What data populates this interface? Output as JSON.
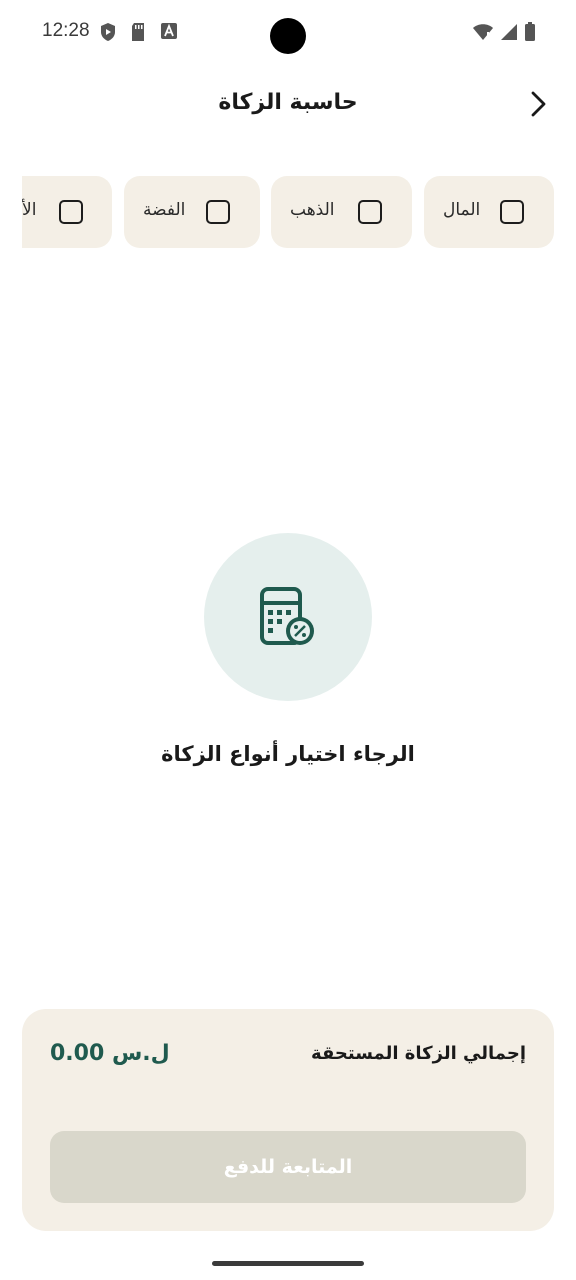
{
  "status_bar": {
    "time": "12:28",
    "left_icons": [
      "play-protect-icon",
      "sd-card-icon",
      "text-icon"
    ],
    "right_icons": [
      "wifi-icon",
      "signal-icon",
      "battery-icon"
    ]
  },
  "header": {
    "title": "حاسبة الزكاة",
    "back_icon": "chevron-right-icon"
  },
  "zakat_types": [
    {
      "label": "المال",
      "checked": false
    },
    {
      "label": "الذهب",
      "checked": false
    },
    {
      "label": "الفضة",
      "checked": false
    },
    {
      "label": "الأ",
      "checked": false
    }
  ],
  "empty_state": {
    "icon": "calculator-percent-icon",
    "message": "الرجاء اختيار أنواع الزكاة"
  },
  "summary": {
    "total_label": "إجمالي الزكاة المستحقة",
    "total_amount": "0.00 ل.س",
    "pay_button_label": "المتابعة للدفع",
    "pay_button_enabled": false
  },
  "colors": {
    "accent": "#1f5a4e",
    "chip_background": "#f4efe6",
    "illustration_background": "#e5efed",
    "disabled_button": "#d9d7cb"
  }
}
